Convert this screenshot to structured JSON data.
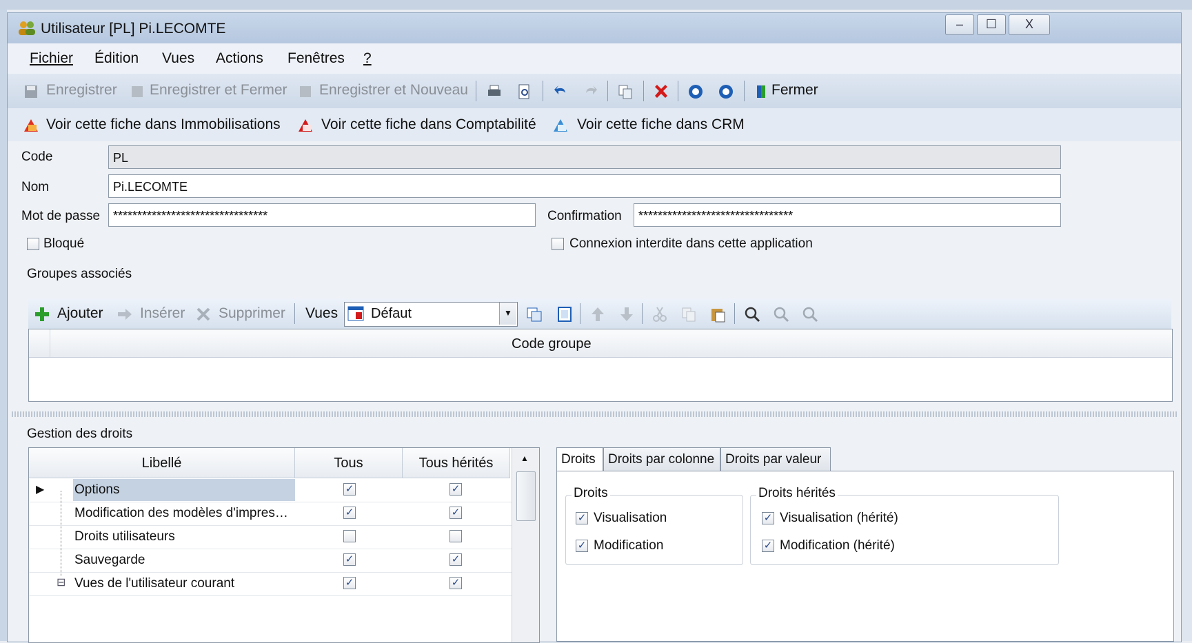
{
  "window": {
    "title": "Utilisateur [PL] Pi.LECOMTE",
    "minimize": "–",
    "maximize": "☐",
    "close": "X"
  },
  "menu": [
    "Fichier",
    "Édition",
    "Vues",
    "Actions",
    "Fenêtres",
    "?"
  ],
  "toolbar": {
    "save": "Enregistrer",
    "save_close": "Enregistrer et Fermer",
    "save_new": "Enregistrer et Nouveau",
    "close": "Fermer"
  },
  "links": [
    "Voir cette fiche dans Immobilisations",
    "Voir cette fiche dans Comptabilité",
    "Voir cette fiche dans CRM"
  ],
  "form": {
    "code_label": "Code",
    "code_value": "PL",
    "nom_label": "Nom",
    "nom_value": "Pi.LECOMTE",
    "password_label": "Mot de passe",
    "password_value": "********************************",
    "confirm_label": "Confirmation",
    "confirm_value": "********************************",
    "blocked_label": "Bloqué",
    "forbidden_label": "Connexion interdite dans cette application"
  },
  "groups": {
    "title": "Groupes associés",
    "add": "Ajouter",
    "insert": "Insérer",
    "delete": "Supprimer",
    "views_label": "Vues",
    "views_value": "Défaut",
    "column": "Code groupe"
  },
  "rights": {
    "title": "Gestion des droits",
    "columns": [
      "Libellé",
      "Tous",
      "Tous hérités"
    ],
    "rows": [
      {
        "label": "Options",
        "all": true,
        "inherited": true
      },
      {
        "label": "Modification des modèles d'impres…",
        "all": true,
        "inherited": true
      },
      {
        "label": "Droits utilisateurs",
        "all": false,
        "inherited": false
      },
      {
        "label": "Sauvegarde",
        "all": true,
        "inherited": true
      },
      {
        "label": "Vues de l'utilisateur courant",
        "all": true,
        "inherited": true
      }
    ],
    "tabs": [
      "Droits",
      "Droits par colonne",
      "Droits par valeur"
    ],
    "droits_group": "Droits",
    "herites_group": "Droits hérités",
    "visualisation": "Visualisation",
    "modification": "Modification",
    "visualisation_h": "Visualisation (hérité)",
    "modification_h": "Modification (hérité)"
  },
  "colors": {
    "accent": "#2b4a8a",
    "delete_red": "#d41a1a",
    "add_green": "#2a9d2a"
  }
}
